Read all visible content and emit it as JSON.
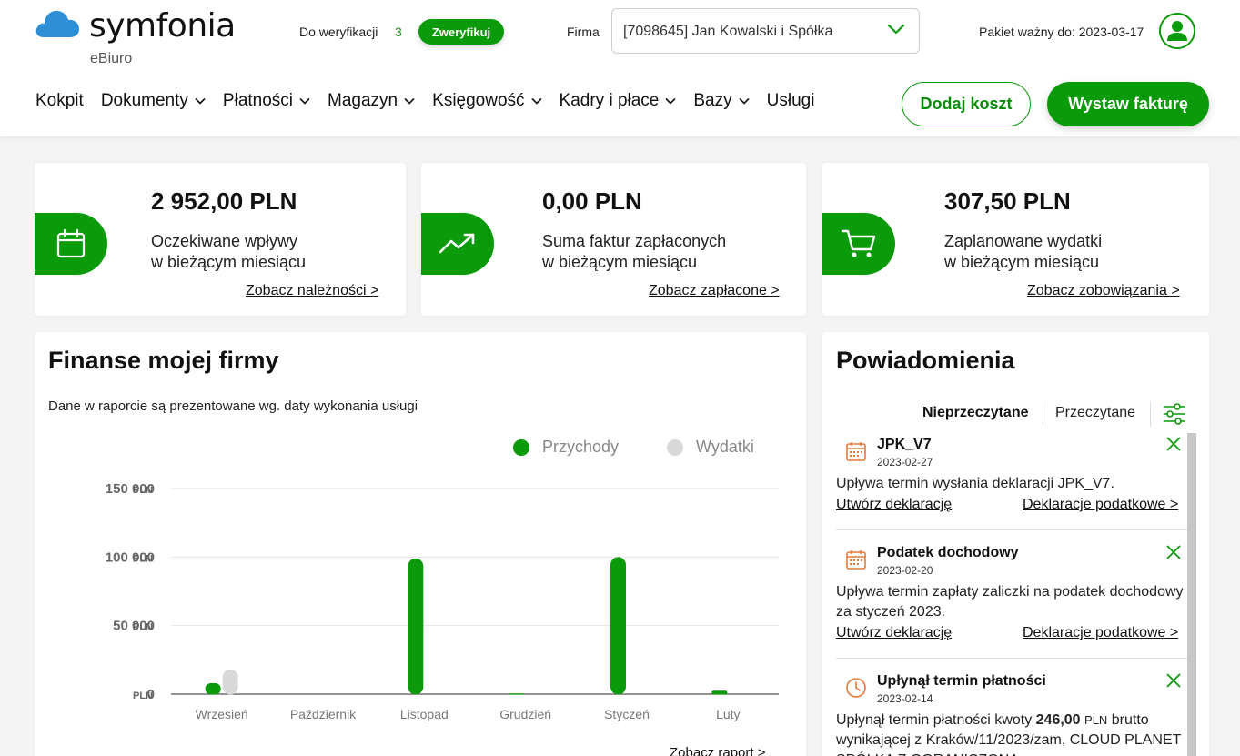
{
  "brand": {
    "name": "symfonia",
    "product": "eBiuro"
  },
  "header": {
    "verify_label": "Do weryfikacji",
    "verify_count": "3",
    "verify_button": "Zweryfikuj",
    "firma_label": "Firma",
    "firma_value": "[7098645] Jan Kowalski i Spółka",
    "pakiet": "Pakiet ważny do: 2023-03-17"
  },
  "nav": {
    "items": [
      {
        "label": "Kokpit",
        "dropdown": false
      },
      {
        "label": "Dokumenty",
        "dropdown": true
      },
      {
        "label": "Płatności",
        "dropdown": true
      },
      {
        "label": "Magazyn",
        "dropdown": true
      },
      {
        "label": "Księgowość",
        "dropdown": true
      },
      {
        "label": "Kadry i płace",
        "dropdown": true
      },
      {
        "label": "Bazy",
        "dropdown": true
      },
      {
        "label": "Usługi",
        "dropdown": false
      }
    ],
    "add_cost": "Dodaj koszt",
    "issue_invoice": "Wystaw fakturę"
  },
  "stats": [
    {
      "amount": "2 952,00 PLN",
      "desc": "Oczekiwane wpływy\nw bieżącym miesiącu",
      "link": "Zobacz należności >",
      "icon": "calendar-icon"
    },
    {
      "amount": "0,00 PLN",
      "desc": "Suma faktur zapłaconych\nw bieżącym miesiącu",
      "link": "Zobacz zapłacone >",
      "icon": "trending-up-icon"
    },
    {
      "amount": "307,50 PLN",
      "desc": "Zaplanowane wydatki\nw bieżącym miesiącu",
      "link": "Zobacz zobowiązania >",
      "icon": "cart-icon"
    }
  ],
  "finance": {
    "title": "Finanse mojej firmy",
    "subtitle": "Dane w raporcie są prezentowane wg. daty wykonania usługi",
    "report_link": "Zobacz raport >"
  },
  "chart_data": {
    "type": "bar",
    "categories": [
      "Wrzesień",
      "Październik",
      "Listopad",
      "Grudzień",
      "Styczeń",
      "Luty"
    ],
    "series": [
      {
        "name": "Przychody",
        "color": "#0a9a0a",
        "values": [
          8000,
          0,
          99000,
          500,
          100000,
          2500
        ]
      },
      {
        "name": "Wydatki",
        "color": "#d9d9d9",
        "values": [
          18000,
          0,
          0,
          0,
          0,
          0
        ]
      }
    ],
    "yticks": [
      0,
      50000,
      100000,
      150000
    ],
    "ytick_labels": [
      "0",
      "50 000",
      "100 000",
      "150 000"
    ],
    "ytick_unit": "PLN",
    "ylim": [
      0,
      150000
    ],
    "grid": true,
    "legend_position": "top-right"
  },
  "notifications": {
    "title": "Powiadomienia",
    "tab_unread": "Nieprzeczytane",
    "tab_read": "Przeczytane",
    "items": [
      {
        "title": "JPK_V7",
        "date": "2023-02-27",
        "body": "Upływa termin wysłania deklaracji JPK_V7.",
        "link1": "Utwórz deklarację",
        "link2": "Deklaracje podatkowe >",
        "icon": "calendar-icon"
      },
      {
        "title": "Podatek dochodowy",
        "date": "2023-02-20",
        "body": "Upływa termin zapłaty zaliczki na podatek dochodowy za styczeń 2023.",
        "link1": "Utwórz deklarację",
        "link2": "Deklaracje podatkowe >",
        "icon": "calendar-icon"
      },
      {
        "title": "Upłynął termin płatności",
        "date": "2023-02-14",
        "body_pre": "Upłynął termin płatności kwoty ",
        "body_amount": "246,00",
        "body_unit": "PLN",
        "body_post": " brutto wynikającej z Kraków/11/2023/zam, CLOUD PLANET SPÓŁKA Z OGRANICZONĄ ODPOWIEDZIALNOŚCIĄ",
        "icon": "clock-icon"
      }
    ]
  },
  "colors": {
    "accent": "#0a9a0a",
    "expense": "#d9d9d9",
    "notif_icon": "#e07a3a"
  }
}
